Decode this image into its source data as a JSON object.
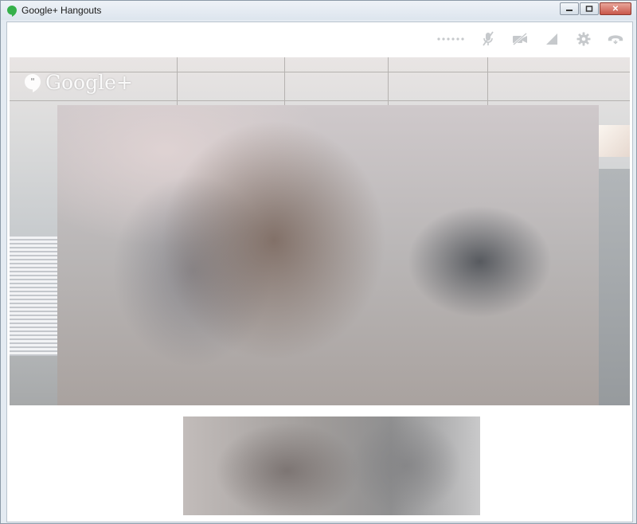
{
  "window": {
    "title": "Google+ Hangouts",
    "controls": {
      "minimize": "▭",
      "maximize": "◻",
      "close": "✕"
    }
  },
  "toolbar": {
    "icons": [
      "signal-strength-dots-icon",
      "mute-mic-icon",
      "camera-off-icon",
      "bandwidth-icon",
      "settings-gear-icon",
      "hang-up-icon"
    ]
  },
  "video": {
    "watermark_text": "Google+"
  },
  "colors": {
    "app_icon_green": "#35b04a",
    "toolbar_icon_gray": "#c6c9cc"
  }
}
